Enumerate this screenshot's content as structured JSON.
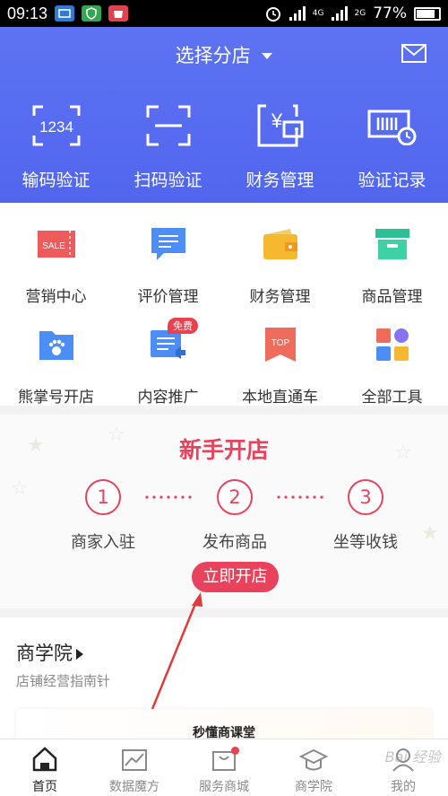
{
  "status_bar": {
    "time": "09:13",
    "network_top": "4G",
    "network_bottom": "2G",
    "battery": "77%"
  },
  "header": {
    "store_select": "选择分店",
    "quick_actions": [
      {
        "label": "输码验证",
        "icon": "keypad-code-icon"
      },
      {
        "label": "扫码验证",
        "icon": "scan-icon"
      },
      {
        "label": "财务管理",
        "icon": "finance-icon"
      },
      {
        "label": "验证记录",
        "icon": "record-icon"
      }
    ]
  },
  "tools": {
    "row1": [
      {
        "label": "营销中心",
        "icon": "sale-ticket-icon"
      },
      {
        "label": "评价管理",
        "icon": "comment-icon"
      },
      {
        "label": "财务管理",
        "icon": "wallet-icon"
      },
      {
        "label": "商品管理",
        "icon": "box-icon"
      }
    ],
    "row2": [
      {
        "label": "熊掌号开店",
        "icon": "paw-folder-icon"
      },
      {
        "label": "内容推广",
        "icon": "content-promote-icon",
        "badge": "免费"
      },
      {
        "label": "本地直通车",
        "icon": "top-bookmark-icon"
      },
      {
        "label": "全部工具",
        "icon": "all-tools-icon"
      }
    ],
    "sale_text": "SALE",
    "top_text": "TOP"
  },
  "new_store": {
    "title": "新手开店",
    "steps": [
      {
        "num": "1",
        "label": "商家入驻"
      },
      {
        "num": "2",
        "label": "发布商品"
      },
      {
        "num": "3",
        "label": "坐等收钱"
      }
    ],
    "button": "立即开店"
  },
  "school": {
    "title": "商学院",
    "subtitle": "店铺经营指南针",
    "card_title": "秒懂商课堂"
  },
  "tabbar": [
    {
      "label": "首页",
      "icon": "home-icon",
      "active": true
    },
    {
      "label": "数据魔方",
      "icon": "chart-icon"
    },
    {
      "label": "服务商城",
      "icon": "shop-bag-icon"
    },
    {
      "label": "商学院",
      "icon": "graduation-cap-icon"
    },
    {
      "label": "我的",
      "icon": "profile-icon"
    }
  ],
  "watermark": "Bai 经验",
  "colors": {
    "header_blue": "#5a6ff2",
    "accent_red": "#e9425c",
    "sale_red": "#ef5b5b",
    "comment_blue": "#4d8ef6",
    "wallet_yellow": "#f6b830",
    "box_green": "#2dbf95"
  }
}
